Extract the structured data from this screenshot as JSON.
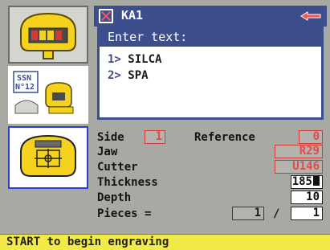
{
  "title": {
    "text": "KA1"
  },
  "icons": {
    "key_card": "key-type-icon",
    "ssn_card": "ssn-key-icon",
    "jaw_card": "clamp-target-icon",
    "title_icon": "checkbox-icon",
    "cutter_icon": "cutter-icon"
  },
  "ssn_card": {
    "line1": "SSN",
    "line2": "N°12"
  },
  "panel": {
    "header": "Enter text:",
    "options": [
      {
        "num": "1>",
        "label": "SILCA"
      },
      {
        "num": "2>",
        "label": "SPA"
      }
    ]
  },
  "params": {
    "side_label": "Side",
    "side_value": "1",
    "reference_label": "Reference",
    "reference_value": "0",
    "jaw_label": "Jaw",
    "jaw_value": "R29",
    "cutter_label": "Cutter",
    "cutter_value": "U146",
    "thickness_label": "Thickness",
    "thickness_value": "185",
    "depth_label": "Depth",
    "depth_value": "10",
    "pieces_label": "Pieces =",
    "pieces_done": "1",
    "pieces_separator": "/",
    "pieces_total": "1"
  },
  "status": {
    "text": "START to begin engraving"
  },
  "colors": {
    "title_bar": "#3c4e8c",
    "status_bar": "#f2ea46",
    "highlight_red": "#e24a4a",
    "key_yellow": "#f5d21e"
  }
}
